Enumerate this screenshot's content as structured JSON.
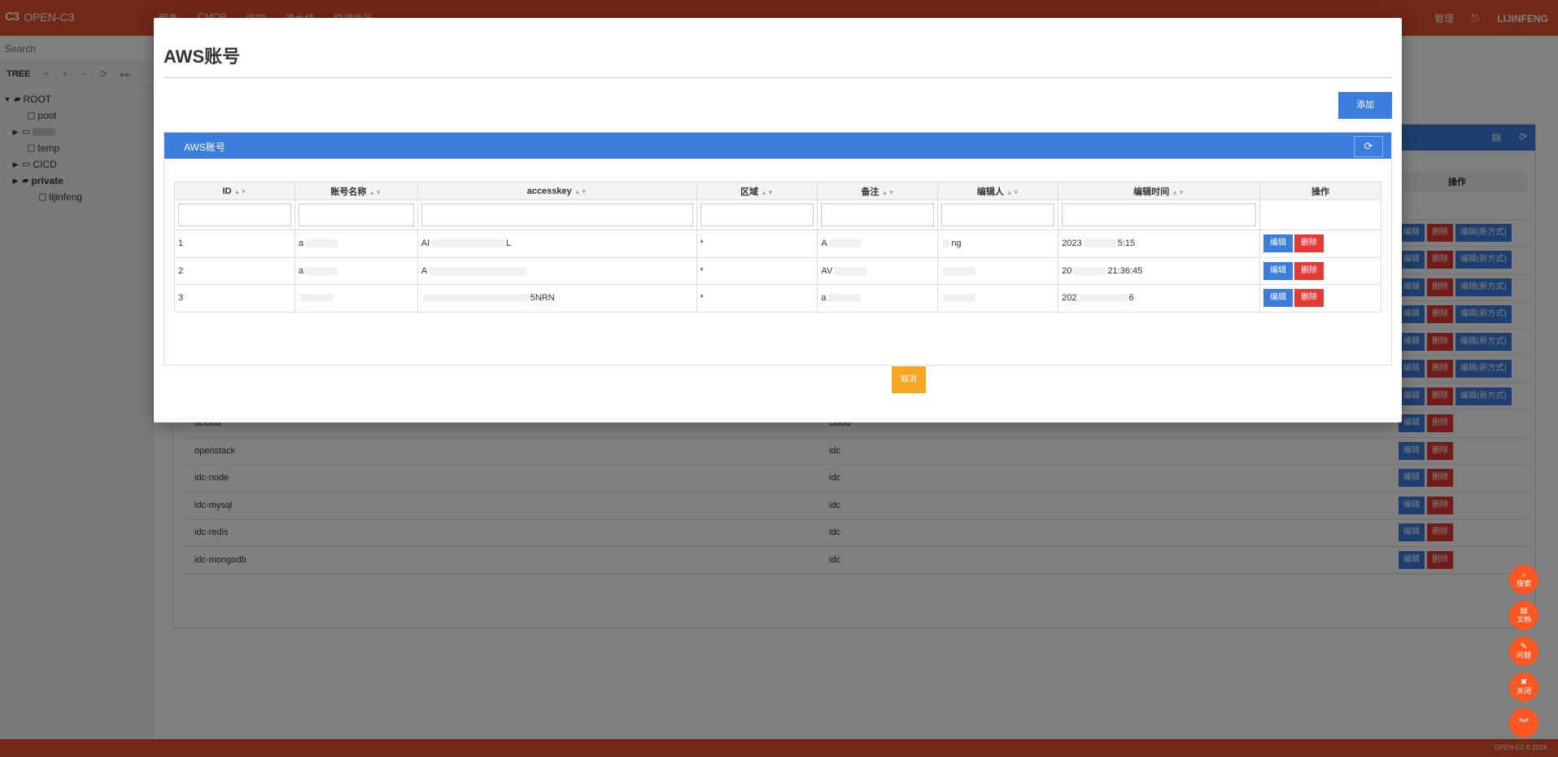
{
  "app": {
    "brand": "OPEN-C3",
    "nav": [
      "服务",
      "CMDB",
      "监控",
      "流水线",
      "快速执行"
    ],
    "admin_label": "管理",
    "user": "LIJINFENG",
    "footer": "OPEN-C3 © 2024"
  },
  "sidebar": {
    "search_placeholder": "Search",
    "tree_label": "TREE",
    "nodes": {
      "root": "ROOT",
      "pool": "pool",
      "temp": "temp",
      "cicd": "CICD",
      "private": "private",
      "lijinfeng": "lijinfeng"
    }
  },
  "background": {
    "action_header": "操作",
    "rows": [
      {
        "name": "ucloud",
        "type": "cloud"
      },
      {
        "name": "openstack",
        "type": "idc"
      },
      {
        "name": "idc-node",
        "type": "idc"
      },
      {
        "name": "idc-mysql",
        "type": "idc"
      },
      {
        "name": "idc-redis",
        "type": "idc"
      },
      {
        "name": "idc-mongodb",
        "type": "idc"
      }
    ],
    "edit_label": "编辑",
    "delete_label": "删除",
    "edit_new_label": "编辑(新方式)"
  },
  "fabs": [
    {
      "icon": "search-icon",
      "label": "搜索"
    },
    {
      "icon": "book-icon",
      "label": "文档"
    },
    {
      "icon": "edit-icon",
      "label": "问题"
    },
    {
      "icon": "close-icon",
      "label": "关闭"
    },
    {
      "icon": "chevron-down-icon",
      "label": ""
    }
  ],
  "modal": {
    "title": "AWS账号",
    "add_button": "添加",
    "panel_title": "AWS账号",
    "columns": [
      "ID",
      "账号名称",
      "accesskey",
      "区域",
      "备注",
      "编辑人",
      "编辑时间",
      "操作"
    ],
    "rows": [
      {
        "id": "1",
        "name": "a",
        "accesskey": "AI",
        "accesskey_tail": "L",
        "region": "*",
        "note": "A",
        "editor": "ng",
        "time": "2023",
        "time_tail": "5:15"
      },
      {
        "id": "2",
        "name": "a",
        "accesskey": "A",
        "accesskey_tail": "",
        "region": "*",
        "note": "AV",
        "editor": "",
        "time": "20",
        "time_tail": "21:36:45"
      },
      {
        "id": "3",
        "name": "",
        "accesskey": "",
        "accesskey_tail": "5NRN",
        "region": "*",
        "note": "a",
        "editor": "",
        "time": "202",
        "time_tail": "6"
      }
    ],
    "edit_label": "编辑",
    "delete_label": "删除",
    "cancel_button": "取消"
  }
}
